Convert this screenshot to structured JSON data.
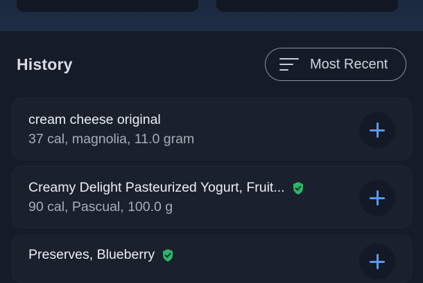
{
  "history": {
    "title": "History",
    "sort_label": "Most Recent"
  },
  "items": [
    {
      "name": "cream cheese original",
      "detail": "37 cal, magnolia, 11.0 gram",
      "verified": false
    },
    {
      "name": "Creamy Delight Pasteurized Yogurt, Fruit...",
      "detail": "90 cal, Pascual, 100.0 g",
      "verified": true
    },
    {
      "name": "Preserves, Blueberry",
      "detail": "",
      "verified": true
    }
  ],
  "colors": {
    "background": "#151b27",
    "card": "#1a212d",
    "accent_plus": "#5a9cf0",
    "verified_green": "#2fb56a"
  },
  "icons": {
    "sort": "sort-lines-icon",
    "add": "plus-icon",
    "verified": "verified-shield-icon"
  }
}
